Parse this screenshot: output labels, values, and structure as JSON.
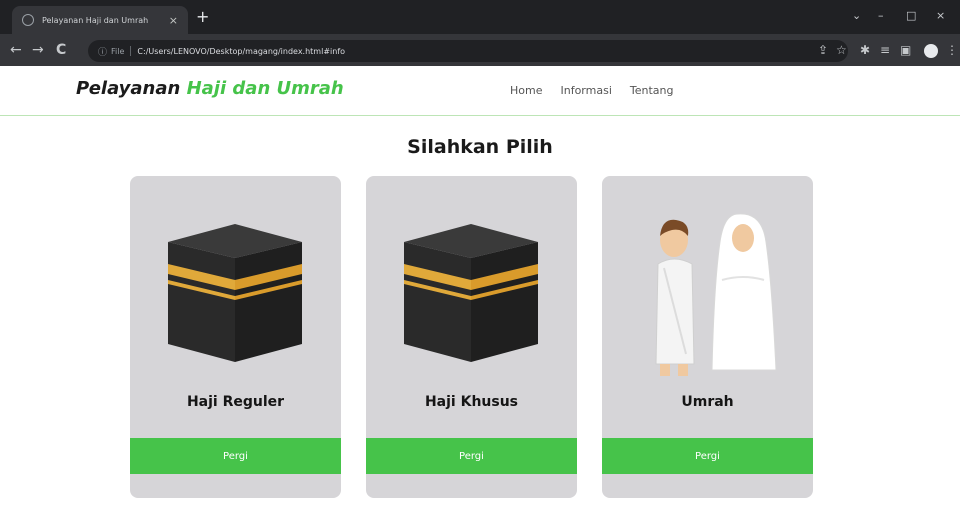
{
  "browser": {
    "tab_title": "Pelayanan Haji dan Umrah",
    "tab_close": "×",
    "new_tab": "+",
    "controls": {
      "minimize": "–",
      "maximize": "□",
      "close": "×"
    },
    "nav": {
      "back": "←",
      "forward": "→",
      "reload": "C"
    },
    "omnibox": {
      "info": "ⓘ",
      "scheme": "File",
      "url": "C:/Users/LENOVO/Desktop/magang/index.html#info"
    }
  },
  "site": {
    "brand_main": "Pelayanan ",
    "brand_accent": "Haji dan Umrah",
    "nav_links": [
      "Home",
      "Informasi",
      "Tentang"
    ],
    "heading": "Silahkan Pilih",
    "cards": [
      {
        "title": "Haji Reguler",
        "button": "Pergi",
        "image": "kaaba-image"
      },
      {
        "title": "Haji Khusus",
        "button": "Pergi",
        "image": "kaaba-image"
      },
      {
        "title": "Umrah",
        "button": "Pergi",
        "image": "pilgrims-image"
      }
    ]
  },
  "colors": {
    "accent": "#46c34a",
    "card_bg": "#d6d5d8",
    "header_line": "#bde5b6"
  }
}
